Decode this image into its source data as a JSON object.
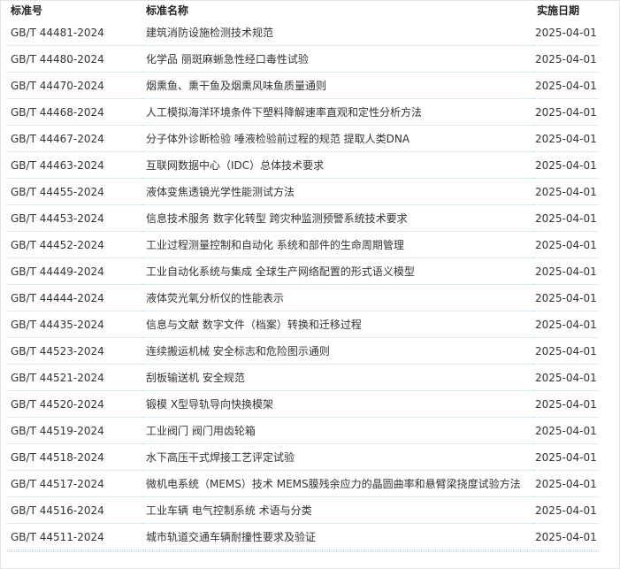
{
  "headers": {
    "standard_no": "标准号",
    "standard_name": "标准名称",
    "effective_date": "实施日期"
  },
  "rows": [
    {
      "no": "GB/T 44481-2024",
      "name": "建筑消防设施检测技术规范",
      "date": "2025-04-01"
    },
    {
      "no": "GB/T 44480-2024",
      "name": "化学品 丽斑麻蜥急性经口毒性试验",
      "date": "2025-04-01"
    },
    {
      "no": "GB/T 44470-2024",
      "name": "烟熏鱼、熏干鱼及烟熏风味鱼质量通则",
      "date": "2025-04-01"
    },
    {
      "no": "GB/T 44468-2024",
      "name": "人工模拟海洋环境条件下塑料降解速率直观和定性分析方法",
      "date": "2025-04-01"
    },
    {
      "no": "GB/T 44467-2024",
      "name": "分子体外诊断检验 唾液检验前过程的规范 提取人类DNA",
      "date": "2025-04-01"
    },
    {
      "no": "GB/T 44463-2024",
      "name": "互联网数据中心（IDC）总体技术要求",
      "date": "2025-04-01"
    },
    {
      "no": "GB/T 44455-2024",
      "name": "液体变焦透镜光学性能测试方法",
      "date": "2025-04-01"
    },
    {
      "no": "GB/T 44453-2024",
      "name": "信息技术服务 数字化转型 跨灾种监测预警系统技术要求",
      "date": "2025-04-01"
    },
    {
      "no": "GB/T 44452-2024",
      "name": "工业过程测量控制和自动化 系统和部件的生命周期管理",
      "date": "2025-04-01"
    },
    {
      "no": "GB/T 44449-2024",
      "name": "工业自动化系统与集成 全球生产网络配置的形式语义模型",
      "date": "2025-04-01"
    },
    {
      "no": "GB/T 44444-2024",
      "name": "液体荧光氧分析仪的性能表示",
      "date": "2025-04-01"
    },
    {
      "no": "GB/T 44435-2024",
      "name": "信息与文献 数字文件（档案）转换和迁移过程",
      "date": "2025-04-01"
    },
    {
      "no": "GB/T 44523-2024",
      "name": "连续搬运机械 安全标志和危险图示通则",
      "date": "2025-04-01"
    },
    {
      "no": "GB/T 44521-2024",
      "name": "刮板输送机 安全规范",
      "date": "2025-04-01"
    },
    {
      "no": "GB/T 44520-2024",
      "name": "锻模 X型导轨导向快换模架",
      "date": "2025-04-01"
    },
    {
      "no": "GB/T 44519-2024",
      "name": "工业阀门 阀门用齿轮箱",
      "date": "2025-04-01"
    },
    {
      "no": "GB/T 44518-2024",
      "name": "水下高压干式焊接工艺评定试验",
      "date": "2025-04-01"
    },
    {
      "no": "GB/T 44517-2024",
      "name": "微机电系统（MEMS）技术 MEMS膜残余应力的晶圆曲率和悬臂梁挠度试验方法",
      "date": "2025-04-01"
    },
    {
      "no": "GB/T 44516-2024",
      "name": "工业车辆 电气控制系统 术语与分类",
      "date": "2025-04-01"
    },
    {
      "no": "GB/T 44511-2024",
      "name": "城市轨道交通车辆耐撞性要求及验证",
      "date": "2025-04-01"
    }
  ]
}
